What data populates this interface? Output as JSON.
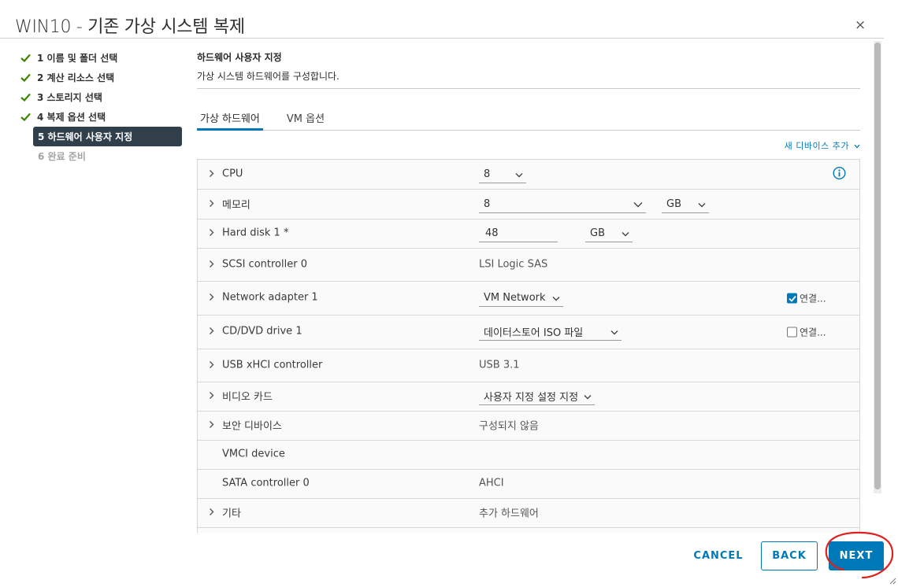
{
  "window": {
    "title": "WIN10 - 기존 가상 시스템 복제",
    "close_symbol": "×"
  },
  "steps": [
    {
      "label": "1 이름 및 폴더 선택",
      "state": "done"
    },
    {
      "label": "2 계산 리소스 선택",
      "state": "done"
    },
    {
      "label": "3 스토리지 선택",
      "state": "done"
    },
    {
      "label": "4 복제 옵션 선택",
      "state": "done"
    },
    {
      "label": "5 하드웨어 사용자 지정",
      "state": "active"
    },
    {
      "label": "6 완료 준비",
      "state": "pending"
    }
  ],
  "section": {
    "title": "하드웨어 사용자 지정",
    "subtitle": "가상 시스템 하드웨어를 구성합니다."
  },
  "tabs": [
    {
      "label": "가상 하드웨어",
      "active": true
    },
    {
      "label": "VM 옵션",
      "active": false
    }
  ],
  "add_device": {
    "label": "새 디바이스 추가"
  },
  "hardware": {
    "cpu": {
      "label": "CPU",
      "value": "8"
    },
    "memory": {
      "label": "메모리",
      "value": "8",
      "unit": "GB"
    },
    "disk": {
      "label": "Hard disk 1 *",
      "value": "48",
      "unit": "GB"
    },
    "scsi": {
      "label": "SCSI controller 0",
      "value": "LSI Logic SAS"
    },
    "network": {
      "label": "Network adapter 1",
      "value": "VM Network",
      "connect_label": "연결...",
      "connected": true
    },
    "cddvd": {
      "label": "CD/DVD drive 1",
      "value": "데이터스토어 ISO 파일",
      "connect_label": "연결...",
      "connected": false
    },
    "usb": {
      "label": "USB xHCI controller",
      "value": "USB 3.1"
    },
    "video": {
      "label": "비디오 카드",
      "value": "사용자 지정 설정 지정"
    },
    "security": {
      "label": "보안 디바이스",
      "value": "구성되지 않음"
    },
    "vmci": {
      "label": "VMCI device",
      "value": ""
    },
    "sata": {
      "label": "SATA controller 0",
      "value": "AHCI"
    },
    "other": {
      "label": "기타",
      "value": "추가 하드웨어"
    }
  },
  "footer": {
    "cancel_label": "CANCEL",
    "back_label": "BACK",
    "next_label": "NEXT"
  },
  "colors": {
    "accent": "#0079b8",
    "active_step_bg": "#313f4b",
    "check_green": "#3c8500",
    "annotation_red": "#e0201c"
  },
  "icons": {
    "check": "check-icon",
    "expand": "chevron-right-icon",
    "dropdown": "chevron-down-icon",
    "info": "info-circle-icon",
    "close": "close-icon"
  }
}
